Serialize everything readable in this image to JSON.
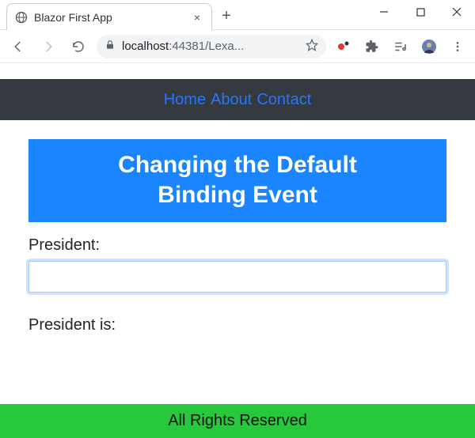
{
  "browser": {
    "tab_title": "Blazor First App",
    "url_host": "localhost",
    "url_port_path": ":44381/Lexa...",
    "new_tab_glyph": "+",
    "close_glyph": "×"
  },
  "navbar": {
    "links": [
      "Home",
      "About",
      "Contact"
    ]
  },
  "main": {
    "banner_line1": "Changing the Default",
    "banner_line2": "Binding Event",
    "label": "President:",
    "input_value": "",
    "result_prefix": "President is:"
  },
  "footer": {
    "text": "All Rights Reserved"
  },
  "icons": {
    "favicon": "globe-icon",
    "back": "arrow-left-icon",
    "forward": "arrow-right-icon",
    "reload": "reload-icon",
    "lock": "lock-icon",
    "star": "star-icon",
    "ext1": "red-dot-icon",
    "ext2": "puzzle-icon",
    "ext3": "media-list-icon",
    "avatar": "avatar-icon",
    "menu": "kebab-icon"
  }
}
